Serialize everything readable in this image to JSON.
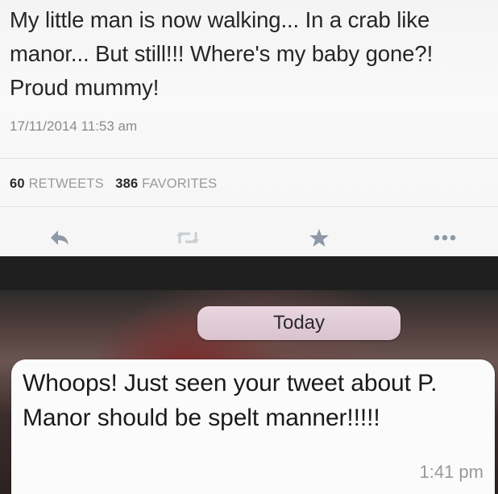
{
  "tweet": {
    "text": "My little man is now walking... In a crab like manor... But still!!! Where's my baby gone?! Proud mummy!",
    "timestamp": "17/11/2014 11:53 am",
    "retweet_count": "60",
    "retweet_label": "RETWEETS",
    "favorite_count": "386",
    "favorite_label": "FAVORITES",
    "actions": [
      "reply-icon",
      "retweet-icon",
      "favorite-star-icon",
      "more-dots-icon"
    ]
  },
  "message": {
    "day_label": "Today",
    "text": "Whoops! Just seen your tweet about P. Manor should be spelt manner!!!!!",
    "time": "1:41 pm"
  }
}
